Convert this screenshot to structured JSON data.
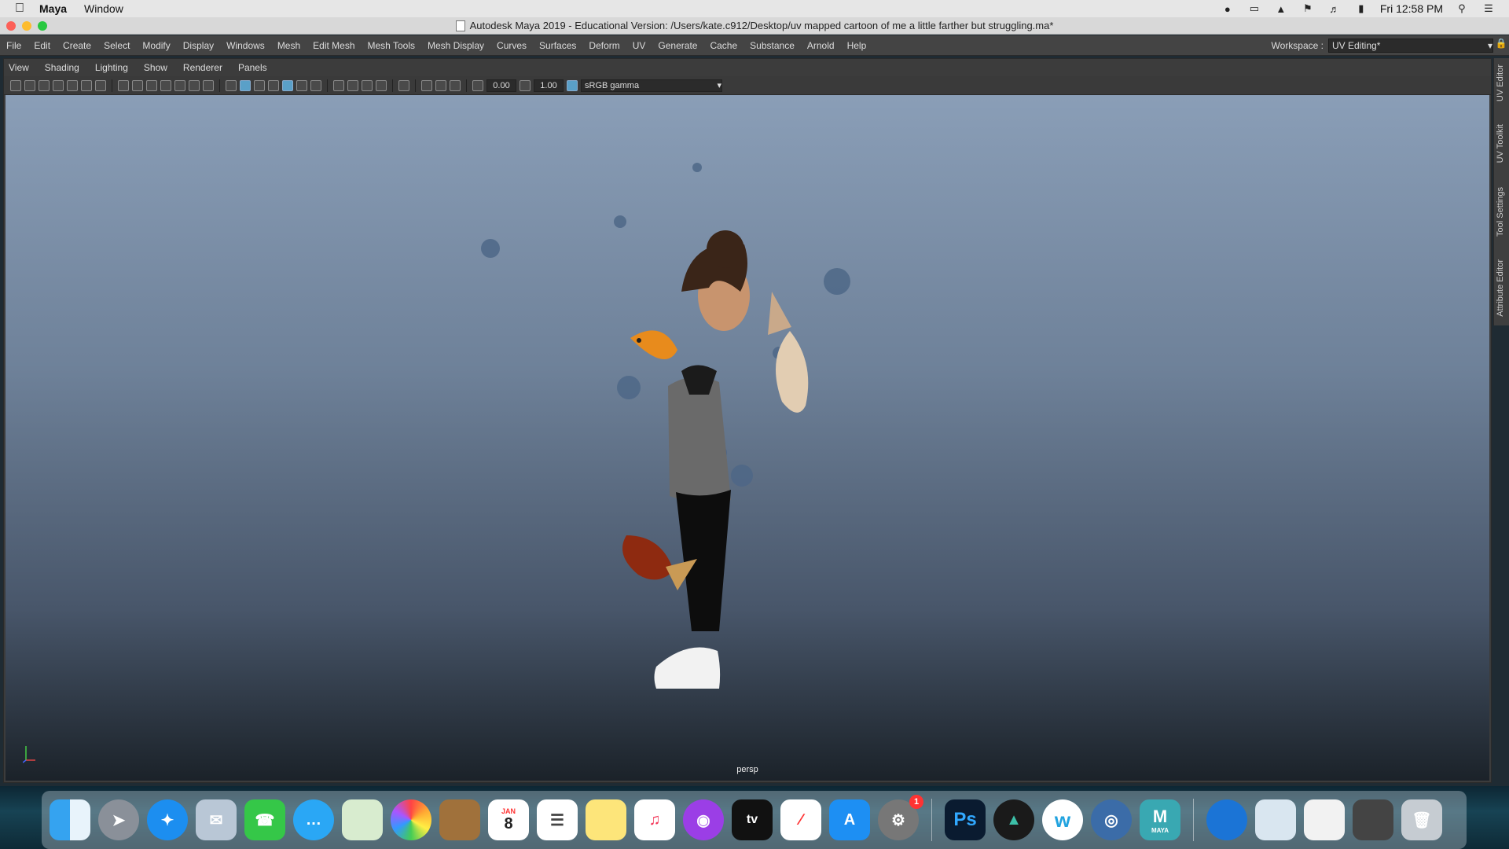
{
  "macos_menubar": {
    "app_name": "Maya",
    "menus": [
      "Window"
    ],
    "clock": "Fri 12:58 PM"
  },
  "window": {
    "title": "Autodesk Maya 2019 - Educational Version: /Users/kate.c912/Desktop/uv mapped cartoon of me a little farther but struggling.ma*"
  },
  "maya_menu": {
    "items": [
      "File",
      "Edit",
      "Create",
      "Select",
      "Modify",
      "Display",
      "Windows",
      "Mesh",
      "Edit Mesh",
      "Mesh Tools",
      "Mesh Display",
      "Curves",
      "Surfaces",
      "Deform",
      "UV",
      "Generate",
      "Cache",
      "Substance",
      "Arnold",
      "Help"
    ],
    "workspace_label": "Workspace :",
    "workspace_value": "UV Editing*"
  },
  "panel": {
    "menus": [
      "View",
      "Shading",
      "Lighting",
      "Show",
      "Renderer",
      "Panels"
    ],
    "exposure_value": "0.00",
    "gamma_value": "1.00",
    "color_management": "sRGB gamma",
    "camera_label": "persp"
  },
  "right_shelf_tabs": [
    "UV Editor",
    "UV Toolkit",
    "Tool Settings",
    "Attribute Editor"
  ],
  "dock": {
    "calendar_month": "JAN",
    "calendar_day": "8",
    "system_prefs_badge": "1",
    "photoshop_label": "Ps",
    "tv_label": "tv",
    "maya_label": "MAYA"
  },
  "colors": {
    "maya_menu_bg": "#444444",
    "viewport_top": "#8a9eb7",
    "viewport_bottom": "#1b2229"
  }
}
